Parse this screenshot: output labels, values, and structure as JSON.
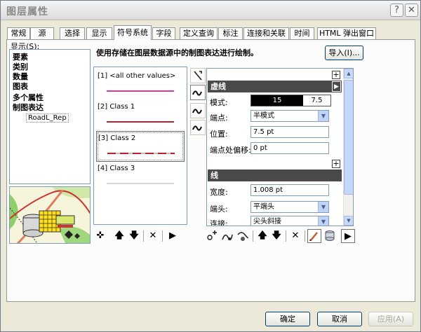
{
  "window": {
    "title": "图层属性",
    "help_label": "?",
    "close_label": "✕"
  },
  "tabs": [
    {
      "label": "常规"
    },
    {
      "label": "源"
    },
    {
      "label": "选择"
    },
    {
      "label": "显示"
    },
    {
      "label": "符号系统",
      "active": true
    },
    {
      "label": "字段"
    },
    {
      "label": "定义查询"
    },
    {
      "label": "标注"
    },
    {
      "label": "连接和关联"
    },
    {
      "label": "时间"
    },
    {
      "label": "HTML 弹出窗口"
    }
  ],
  "show": {
    "label": "显示(S):",
    "items": [
      "要素",
      "类别",
      "数量",
      "图表",
      "多个属性",
      "制图表达"
    ],
    "sub_item": "RoadL_Rep"
  },
  "description": "使用存储在图层数据源中的制图表达进行绘制。",
  "import_button": "导入(I)...",
  "classes": [
    {
      "label": "[1] <all other values>",
      "color": "#e0389a",
      "style": "solid"
    },
    {
      "label": "[2] Class 1",
      "color": "#c01f2e",
      "style": "solid"
    },
    {
      "label": "[3] Class 2",
      "color": "#c01f2e",
      "style": "dashed-gray"
    },
    {
      "label": "[4] Class 3",
      "color": "#b0b0b0",
      "style": "solid"
    }
  ],
  "class_toolbar": {
    "add": "✜",
    "up": "🡅",
    "down": "🡇",
    "remove": "✕",
    "more": "▶"
  },
  "properties": {
    "dash_section": "虚线",
    "pattern_label": "模式:",
    "pattern_values": [
      "15",
      "7.5"
    ],
    "endpoint_label": "端点:",
    "endpoint_value": "半模式",
    "position_label": "位置:",
    "position_value": "7.5 pt",
    "end_offset_label": "端点处偏移:",
    "end_offset_value": "0 pt",
    "line_section": "线",
    "width_label": "宽度:",
    "width_value": "1.008 pt",
    "cap_label": "端头:",
    "cap_value": "平端头",
    "join_label": "连接:",
    "join_value": "尖头斜接"
  },
  "footer": {
    "ok": "确定",
    "cancel": "取消",
    "apply": "应用(A)"
  }
}
